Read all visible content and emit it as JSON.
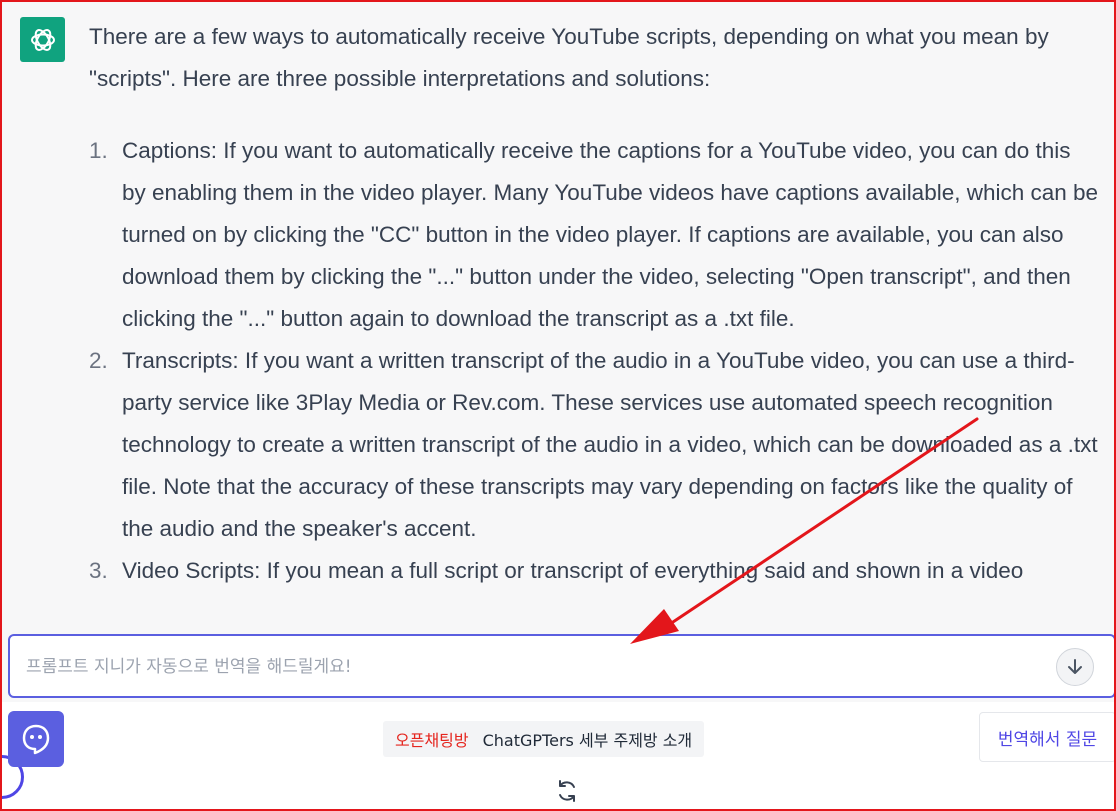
{
  "response": {
    "intro": "There are a few ways to automatically receive YouTube scripts, depending on what you mean by \"scripts\". Here are three possible interpretations and solutions:",
    "items": [
      {
        "number": "1.",
        "text": "Captions: If you want to automatically receive the captions for a YouTube video, you can do this by enabling them in the video player. Many YouTube videos have captions available, which can be turned on by clicking the \"CC\" button in the video player. If captions are available, you can also download them by clicking the \"...\" button under the video, selecting \"Open transcript\", and then clicking the \"...\" button again to download the transcript as a .txt file."
      },
      {
        "number": "2.",
        "text": "Transcripts: If you want a written transcript of the audio in a YouTube video, you can use a third-party service like 3Play Media or Rev.com. These services use automated speech recognition technology to create a written transcript of the audio in a video, which can be downloaded as a .txt file. Note that the accuracy of these transcripts may vary depending on factors like the quality of the audio and the speaker's accent."
      },
      {
        "number": "3.",
        "text": "Video Scripts: If you mean a full script or transcript of everything said and shown in a video"
      }
    ]
  },
  "icons": {
    "assistant_avatar": "openai-logo-icon",
    "send": "arrow-down-icon",
    "bot": "chat-bot-icon",
    "regenerate": "refresh-icon"
  },
  "prompt": {
    "placeholder": "프롬프트 지니가 자동으로 번역을 해드릴게요!",
    "value": ""
  },
  "footer": {
    "open_chat_label": "오픈채팅방",
    "subroom_label": "ChatGPTers 세부 주제방 소개",
    "translate_button": "번역해서 질문"
  },
  "colors": {
    "frame_border": "#e3161b",
    "accent": "#5b5fe0",
    "avatar_bg": "#10a37f",
    "annotation_arrow": "#e3161b",
    "open_chat": "#e5261f"
  }
}
